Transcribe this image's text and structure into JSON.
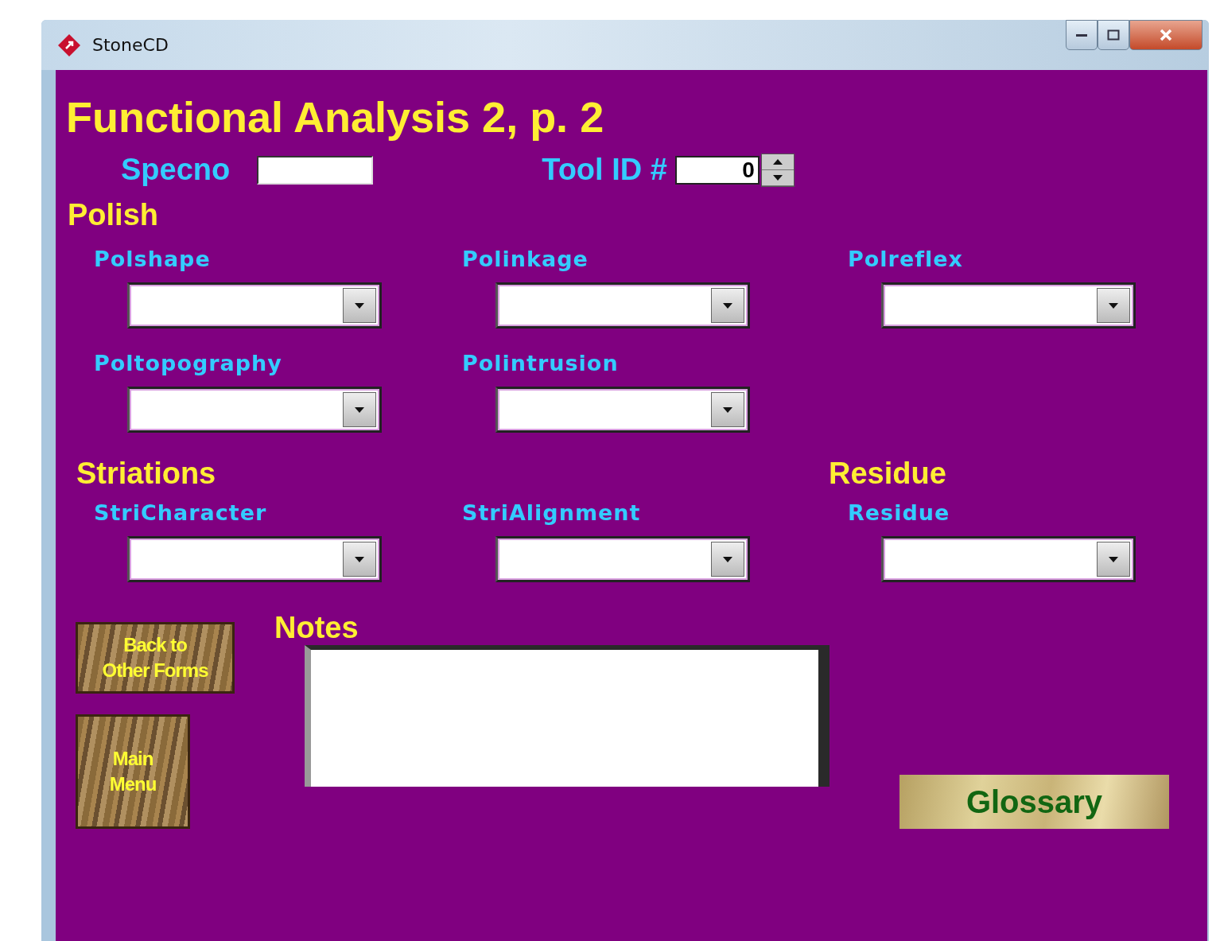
{
  "window": {
    "title": "StoneCD"
  },
  "form_title": "Functional Analysis 2, p. 2",
  "specno": {
    "label": "Specno"
  },
  "tool_id": {
    "label": "Tool ID #",
    "value": "0"
  },
  "sections": [
    {
      "heading": "Polish",
      "fields": [
        {
          "label": "Polshape"
        },
        {
          "label": "Polinkage"
        },
        {
          "label": "Polreflex"
        },
        {
          "label": "Poltopography"
        },
        {
          "label": "Polintrusion"
        }
      ]
    },
    {
      "heading": "Striations",
      "fields": [
        {
          "label": "StriCharacter"
        },
        {
          "label": "StriAlignment"
        }
      ]
    },
    {
      "heading": "Residue",
      "fields": [
        {
          "label": "Residue"
        }
      ]
    }
  ],
  "notes": {
    "label": "Notes"
  },
  "buttons": [
    {
      "label": "Back to Other Forms",
      "kind": "wide"
    },
    {
      "label": "Main Menu",
      "kind": "square"
    }
  ],
  "glossary": {
    "label": "Glossary"
  }
}
